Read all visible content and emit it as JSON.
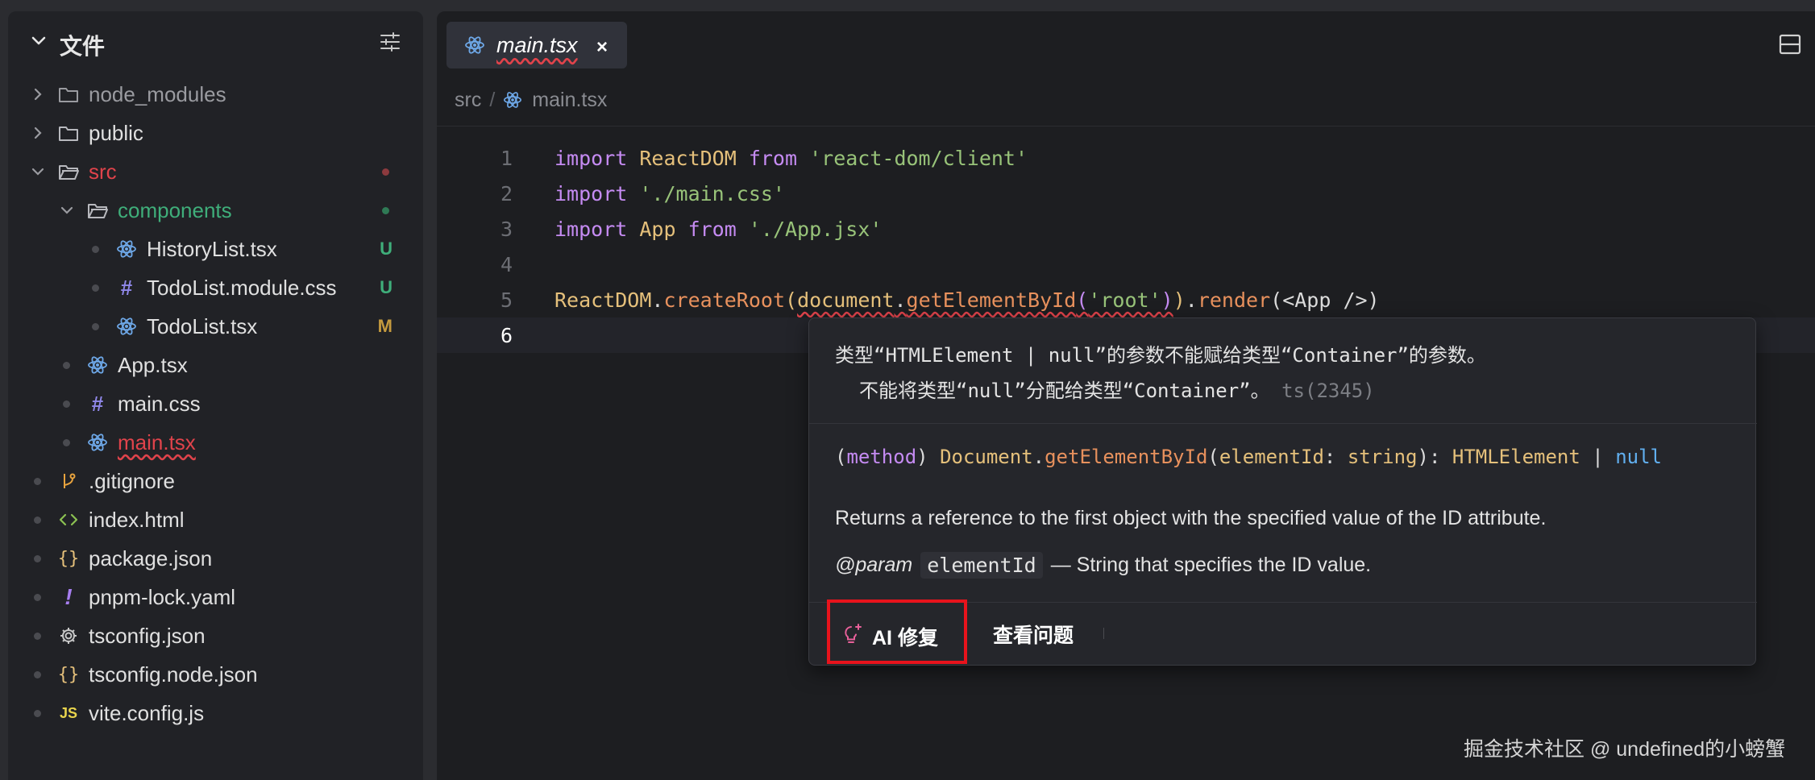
{
  "sidebar": {
    "title": "文件",
    "items": [
      {
        "label": "node_modules",
        "type": "folder",
        "expanded": false,
        "color": "#9a9ba0"
      },
      {
        "label": "public",
        "type": "folder",
        "expanded": false,
        "color": "#e0e0e0"
      },
      {
        "label": "src",
        "type": "folder",
        "expanded": true,
        "color": "#e0434b"
      },
      {
        "label": "components",
        "type": "folder",
        "expanded": true,
        "color": "#3fae7a"
      },
      {
        "label": "HistoryList.tsx",
        "type": "react",
        "status": "U"
      },
      {
        "label": "TodoList.module.css",
        "type": "css",
        "status": "U"
      },
      {
        "label": "TodoList.tsx",
        "type": "react",
        "status": "M"
      },
      {
        "label": "App.tsx",
        "type": "react"
      },
      {
        "label": "main.css",
        "type": "css"
      },
      {
        "label": "main.tsx",
        "type": "react",
        "color": "#e0434b"
      },
      {
        "label": ".gitignore",
        "type": "git"
      },
      {
        "label": "index.html",
        "type": "html"
      },
      {
        "label": "package.json",
        "type": "json"
      },
      {
        "label": "pnpm-lock.yaml",
        "type": "yaml"
      },
      {
        "label": "tsconfig.json",
        "type": "gear"
      },
      {
        "label": "tsconfig.node.json",
        "type": "json"
      },
      {
        "label": "vite.config.js",
        "type": "js",
        "icon_text": "JS"
      }
    ]
  },
  "editor": {
    "tab_label": "main.tsx",
    "tab_close": "×",
    "breadcrumb": {
      "root": "src",
      "sep": "/",
      "file": "main.tsx"
    },
    "line_numbers": [
      "1",
      "2",
      "3",
      "4",
      "5",
      "6"
    ],
    "code": {
      "l1": {
        "kw1": "import",
        "id1": " ReactDOM ",
        "kw2": "from",
        "str": " 'react-dom/client'"
      },
      "l2": {
        "kw1": "import",
        "str": " './main.css'"
      },
      "l3": {
        "kw1": "import",
        "id1": " App ",
        "kw2": "from",
        "str": " './App.jsx'"
      },
      "l5": {
        "obj": "ReactDOM",
        "dot1": ".",
        "fn1": "createRoot",
        "p1": "(",
        "doc": "document",
        "dot2": ".",
        "fn2": "getElementById",
        "p2": "(",
        "arg": "'root'",
        "p3": "))",
        "dot3": ".",
        "fn3": "render",
        "rest": "(<App />)"
      }
    }
  },
  "popup": {
    "error_line1": "类型“HTMLElement | null”的参数不能赋给类型“Container”的参数。",
    "error_line2": "不能将类型“null”分配给类型“Container”。",
    "error_code": " ts(2345)",
    "signature": {
      "prefix": "(",
      "method_kw": "method",
      "close": ") ",
      "obj": "Document",
      "dot": ".",
      "fn": "getElementById",
      "open": "(",
      "param": "elementId",
      "colon": ": ",
      "ptype": "string",
      "close2": "): ",
      "ret": "HTMLElement",
      "pipe": " | ",
      "nullkw": "null"
    },
    "description": "Returns a reference to the first object with the specified value of the ID attribute.",
    "param_tag": "@param",
    "param_name": "elementId",
    "param_desc": "— String that specifies the ID value.",
    "ai_fix_label": "AI 修复",
    "view_problem_label": "查看问题"
  },
  "watermark": "掘金技术社区 @ undefined的小螃蟹"
}
